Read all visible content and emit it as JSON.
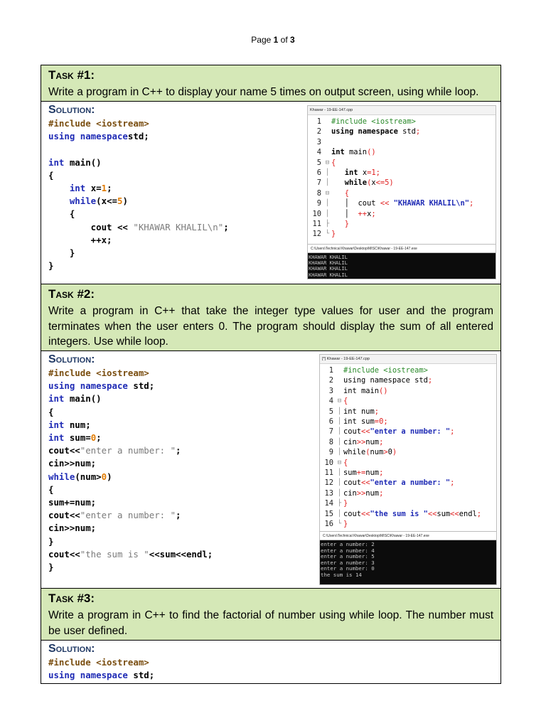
{
  "page_number": {
    "prefix": "Page ",
    "current": "1",
    "mid": " of ",
    "total": "3"
  },
  "tasks": [
    {
      "title": "Task #1:",
      "question": "Write a program in C++ to display your name 5 times on output screen, using while loop.",
      "solution_label": "Solution:",
      "code": [
        [
          [
            "p",
            "#include <iostream>"
          ]
        ],
        [
          [
            "k",
            "using namespace"
          ],
          [
            "",
            "std;"
          ]
        ],
        [],
        [
          [
            "k",
            "int"
          ],
          [
            "",
            " main()"
          ]
        ],
        [
          [
            "",
            "{"
          ]
        ],
        [
          [
            "",
            "    "
          ],
          [
            "k",
            "int"
          ],
          [
            "",
            " x="
          ],
          [
            "n",
            "1"
          ],
          [
            "",
            ";"
          ]
        ],
        [
          [
            "",
            "    "
          ],
          [
            "k",
            "while"
          ],
          [
            "",
            "(x<="
          ],
          [
            "n",
            "5"
          ],
          [
            "",
            ")"
          ]
        ],
        [
          [
            "",
            "    {"
          ]
        ],
        [
          [
            "",
            "        cout << "
          ],
          [
            "s",
            "\"KHAWAR KHALIL\\n\""
          ],
          [
            "",
            ";"
          ]
        ],
        [
          [
            "",
            "        ++x;"
          ]
        ],
        [
          [
            "",
            "    }"
          ]
        ],
        [
          [
            "",
            "}"
          ]
        ]
      ],
      "screenshot": {
        "tab": "Khawar - 19-EE-147.cpp",
        "console_title": "C:\\Users\\Technical Khawar\\Desktop\\MISC\\Khawar - 19-EE-147.exe",
        "lines": [
          {
            "n": "1",
            "g": "",
            "c": [
              [
                "e-p",
                "#include <iostream>"
              ]
            ]
          },
          {
            "n": "2",
            "g": "",
            "c": [
              [
                "e-k",
                "using namespace"
              ],
              [
                "",
                " std"
              ],
              [
                "e-o",
                ";"
              ]
            ]
          },
          {
            "n": "3",
            "g": "",
            "c": []
          },
          {
            "n": "4",
            "g": "",
            "c": [
              [
                "e-k",
                "int"
              ],
              [
                "",
                " main"
              ],
              [
                "e-o",
                "()"
              ]
            ]
          },
          {
            "n": "5",
            "g": "⊟",
            "c": [
              [
                "e-o",
                "{"
              ]
            ]
          },
          {
            "n": "6",
            "g": "│",
            "c": [
              [
                "",
                "   "
              ],
              [
                "e-k",
                "int"
              ],
              [
                "",
                " x"
              ],
              [
                "e-o",
                "="
              ],
              [
                "e-n",
                "1"
              ],
              [
                "e-o",
                ";"
              ]
            ]
          },
          {
            "n": "7",
            "g": "│",
            "c": [
              [
                "",
                "   "
              ],
              [
                "e-k",
                "while"
              ],
              [
                "e-o",
                "("
              ],
              [
                "",
                "x"
              ],
              [
                "e-o",
                "<="
              ],
              [
                "e-n",
                "5"
              ],
              [
                "e-o",
                ")"
              ]
            ]
          },
          {
            "n": "8",
            "g": "⊟",
            "c": [
              [
                "",
                "   "
              ],
              [
                "e-o",
                "{"
              ]
            ]
          },
          {
            "n": "9",
            "g": "│",
            "c": [
              [
                "",
                "   │  cout "
              ],
              [
                "e-o",
                "<<"
              ],
              [
                "",
                " "
              ],
              [
                "e-s",
                "\"KHAWAR KHALIL\\n\""
              ],
              [
                "e-o",
                ";"
              ]
            ]
          },
          {
            "n": "10",
            "g": "│",
            "c": [
              [
                "",
                "   │  "
              ],
              [
                "e-o",
                "++"
              ],
              [
                "",
                "x"
              ],
              [
                "e-o",
                ";"
              ]
            ]
          },
          {
            "n": "11",
            "g": "├",
            "c": [
              [
                "",
                "   "
              ],
              [
                "e-o",
                "}"
              ]
            ]
          },
          {
            "n": "12",
            "g": "└",
            "c": [
              [
                "e-o",
                "}"
              ]
            ]
          }
        ],
        "console": [
          "KHAWAR KHALIL",
          "KHAWAR KHALIL",
          "KHAWAR KHALIL",
          "KHAWAR KHALIL",
          "KHAWAR KHALIL"
        ]
      }
    },
    {
      "title": "Task #2:",
      "question": "Write a program in C++ that take the integer type values for user and the program terminates when the user enters 0. The program should display the sum of all entered integers. Use while loop.",
      "solution_label": "Solution:",
      "code": [
        [
          [
            "p",
            "#include <iostream>"
          ]
        ],
        [
          [
            "k",
            "using namespace"
          ],
          [
            "",
            " std;"
          ]
        ],
        [
          [
            "k",
            "int"
          ],
          [
            "",
            " main()"
          ]
        ],
        [
          [
            "",
            "{"
          ]
        ],
        [
          [
            "k",
            "int"
          ],
          [
            "",
            " num;"
          ]
        ],
        [
          [
            "k",
            "int"
          ],
          [
            "",
            " sum="
          ],
          [
            "n",
            "0"
          ],
          [
            "",
            ";"
          ]
        ],
        [
          [
            "",
            "cout<<"
          ],
          [
            "s",
            "\"enter a number: \""
          ],
          [
            "",
            ";"
          ]
        ],
        [
          [
            "",
            "cin>>num;"
          ]
        ],
        [
          [
            "k",
            "while"
          ],
          [
            "",
            "(num>"
          ],
          [
            "n",
            "0"
          ],
          [
            "",
            ")"
          ]
        ],
        [
          [
            "",
            "{"
          ]
        ],
        [
          [
            "",
            "sum+=num;"
          ]
        ],
        [
          [
            "",
            "cout<<"
          ],
          [
            "s",
            "\"enter a number: \""
          ],
          [
            "",
            ";"
          ]
        ],
        [
          [
            "",
            "cin>>num;"
          ]
        ],
        [
          [
            "",
            "}"
          ]
        ],
        [
          [
            "",
            "cout<<"
          ],
          [
            "s",
            "\"the sum is \""
          ],
          [
            "",
            "<<sum<<endl;"
          ]
        ],
        [
          [
            "",
            "}"
          ]
        ]
      ],
      "screenshot": {
        "tab": "[*] Khawar - 19-EE-147.cpp",
        "console_title": "C:\\Users\\Technical Khawar\\Desktop\\MISC\\Khawar - 19-EE-147.exe",
        "lines": [
          {
            "n": "1",
            "g": "",
            "c": [
              [
                "e-p",
                "#include <iostream>"
              ]
            ]
          },
          {
            "n": "2",
            "g": "",
            "c": [
              [
                "",
                "using namespace std"
              ],
              [
                "e-o",
                ";"
              ]
            ]
          },
          {
            "n": "3",
            "g": "",
            "c": [
              [
                "",
                "int main"
              ],
              [
                "e-o",
                "()"
              ]
            ]
          },
          {
            "n": "4",
            "g": "⊟",
            "c": [
              [
                "e-o",
                "{"
              ]
            ]
          },
          {
            "n": "5",
            "g": "│",
            "c": [
              [
                "",
                "int num"
              ],
              [
                "e-o",
                ";"
              ]
            ]
          },
          {
            "n": "6",
            "g": "│",
            "c": [
              [
                "",
                "int sum"
              ],
              [
                "e-o",
                "="
              ],
              [
                "e-n",
                "0"
              ],
              [
                "e-o",
                ";"
              ]
            ]
          },
          {
            "n": "7",
            "g": "│",
            "c": [
              [
                "",
                "cout"
              ],
              [
                "e-o",
                "<<"
              ],
              [
                "e-s",
                "\"enter a number: \""
              ],
              [
                "e-o",
                ";"
              ]
            ]
          },
          {
            "n": "8",
            "g": "│",
            "c": [
              [
                "",
                "cin"
              ],
              [
                "e-o",
                ">>"
              ],
              [
                "",
                "num"
              ],
              [
                "e-o",
                ";"
              ]
            ]
          },
          {
            "n": "9",
            "g": "│",
            "c": [
              [
                "",
                "while"
              ],
              [
                "e-o",
                "("
              ],
              [
                "",
                "num"
              ],
              [
                "e-o",
                ">"
              ],
              [
                "",
                "0"
              ],
              [
                "e-o",
                ")"
              ]
            ]
          },
          {
            "n": "10",
            "g": "⊟",
            "c": [
              [
                "e-o",
                "{"
              ]
            ]
          },
          {
            "n": "11",
            "g": "│",
            "c": [
              [
                "",
                "sum"
              ],
              [
                "e-o",
                "+="
              ],
              [
                "",
                "num"
              ],
              [
                "e-o",
                ";"
              ]
            ]
          },
          {
            "n": "12",
            "g": "│",
            "c": [
              [
                "",
                "cout"
              ],
              [
                "e-o",
                "<<"
              ],
              [
                "e-s",
                "\"enter a number: \""
              ],
              [
                "e-o",
                ";"
              ]
            ]
          },
          {
            "n": "13",
            "g": "│",
            "c": [
              [
                "",
                "cin"
              ],
              [
                "e-o",
                ">>"
              ],
              [
                "",
                "num"
              ],
              [
                "e-o",
                ";"
              ]
            ]
          },
          {
            "n": "14",
            "g": "├",
            "c": [
              [
                "e-o",
                "}"
              ]
            ]
          },
          {
            "n": "15",
            "g": "│",
            "c": [
              [
                "",
                "cout"
              ],
              [
                "e-o",
                "<<"
              ],
              [
                "e-s",
                "\"the sum is \""
              ],
              [
                "e-o",
                "<<"
              ],
              [
                "",
                "sum"
              ],
              [
                "e-o",
                "<<"
              ],
              [
                "",
                "endl"
              ],
              [
                "e-o",
                ";"
              ]
            ]
          },
          {
            "n": "16",
            "g": "└",
            "c": [
              [
                "e-o",
                "}"
              ]
            ]
          }
        ],
        "console": [
          "enter a number: 2",
          "enter a number: 4",
          "enter a number: 5",
          "enter a number: 3",
          "enter a number: 0",
          "the sum is 14"
        ]
      }
    },
    {
      "title": "Task #3:",
      "question": "Write a program in C++ to find the factorial of number using while loop. The number must be user defined.",
      "solution_label": "Solution:",
      "code": [
        [
          [
            "p",
            "#include <iostream>"
          ]
        ],
        [
          [
            "k",
            "using namespace"
          ],
          [
            "",
            " std;"
          ]
        ]
      ]
    }
  ]
}
